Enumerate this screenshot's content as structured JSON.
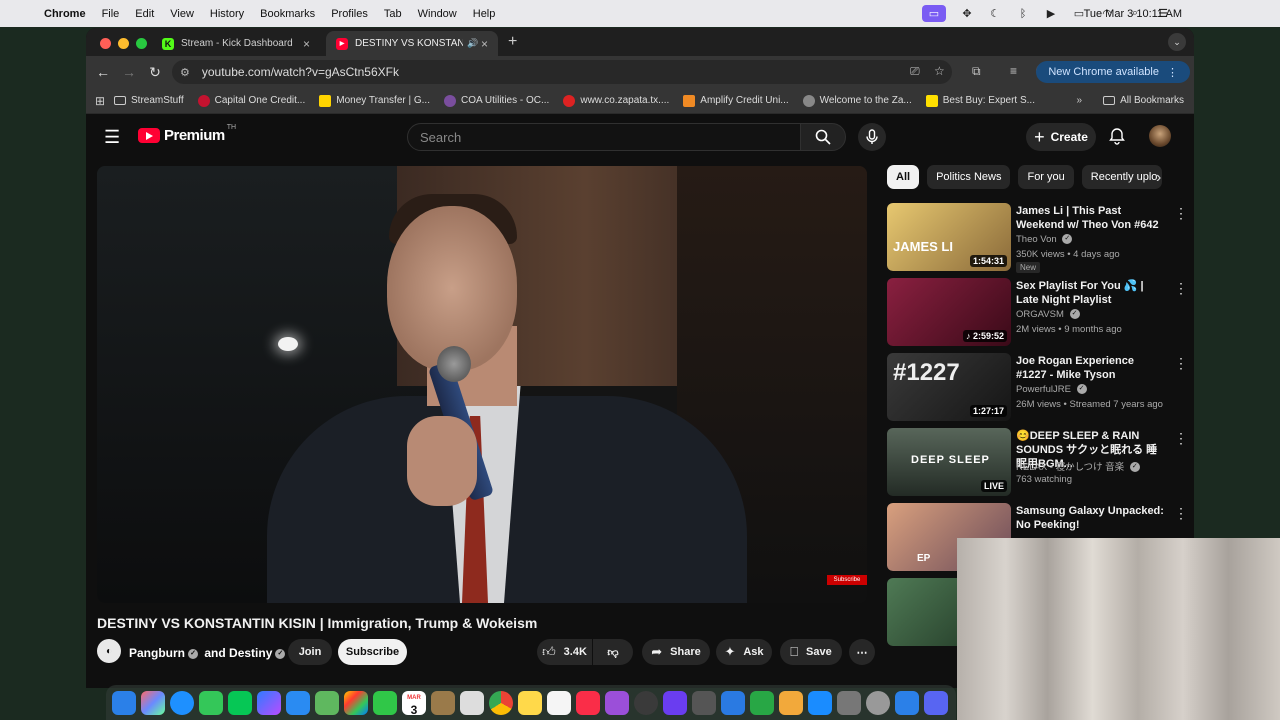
{
  "menubar": {
    "app": "Chrome",
    "items": [
      "File",
      "Edit",
      "View",
      "History",
      "Bookmarks",
      "Profiles",
      "Tab",
      "Window",
      "Help"
    ],
    "clock": "Tue Mar 3  10:11 AM"
  },
  "tabs": [
    {
      "title": "Stream - Kick Dashboard",
      "favicon": "K",
      "color": "#53fc18"
    },
    {
      "title": "DESTINY VS KONSTANTIN",
      "favicon": "▶",
      "color": "#ff0033"
    }
  ],
  "toolbar": {
    "url": "youtube.com/watch?v=gAsCtn56XFk",
    "new_chrome": "New Chrome available"
  },
  "bookmarks": {
    "items": [
      {
        "label": "StreamStuff",
        "icon": "folder-icon"
      },
      {
        "label": "Capital One Credit...",
        "color": "#c4122f"
      },
      {
        "label": "Money Transfer | G...",
        "color": "#ffd400"
      },
      {
        "label": "COA Utilities - OC...",
        "color": "#7a4e9e"
      },
      {
        "label": "www.co.zapata.tx....",
        "color": "#d22"
      },
      {
        "label": "Amplify Credit Uni...",
        "color": "#f08a24"
      },
      {
        "label": "Welcome to the Za...",
        "color": "#888"
      },
      {
        "label": "Best Buy: Expert S...",
        "color": "#ffe000"
      }
    ],
    "more": "»",
    "all": "All Bookmarks"
  },
  "youtube": {
    "logo_text": "Premium",
    "country": "TH",
    "search_placeholder": "Search",
    "create_label": "Create",
    "video": {
      "title": "DESTINY VS KONSTANTIN KISIN | Immigration, Trump & Wokeism",
      "channel_a": "Pangburn",
      "channel_joiner": "and",
      "channel_b": "Destiny",
      "join": "Join",
      "subscribe": "Subscribe",
      "likes": "3.4K",
      "share": "Share",
      "ask": "Ask",
      "save": "Save",
      "watermark": "Subscribe"
    },
    "chips": [
      "All",
      "Politics News",
      "For you",
      "Recently uplo"
    ],
    "recommendations": [
      {
        "title": "James Li | This Past Weekend w/ Theo Von #642",
        "channel": "Theo Von",
        "meta": "350K views • 4 days ago",
        "badge": "New",
        "duration": "1:54:31",
        "thumb_text": "JAMES LI",
        "thumb_bg": "#c9a44a"
      },
      {
        "title": "Sex Playlist For You 💦 | Late Night Playlist",
        "channel": "ORGAVSM",
        "meta": "2M views • 9 months ago",
        "badge": "",
        "duration": "♪ 2:59:52",
        "thumb_text": "",
        "thumb_bg": "#6a1830"
      },
      {
        "title": "Joe Rogan Experience #1227 - Mike Tyson",
        "channel": "PowerfulJRE",
        "meta": "26M views • Streamed 7 years ago",
        "badge": "",
        "duration": "1:27:17",
        "thumb_text": "#1227",
        "thumb_bg": "#2b2b2b"
      },
      {
        "title": "😊DEEP SLEEP & RAIN SOUNDS サクッと眠れる 睡眠用BGM...",
        "channel": "RELAX - 寝かしつけ 音楽",
        "meta": "763 watching",
        "badge": "",
        "duration": "LIVE",
        "thumb_text": "DEEP SLEEP",
        "thumb_bg": "#3b4a40"
      },
      {
        "title": "Samsung Galaxy Unpacked: No Peeking!",
        "channel": "",
        "meta": "",
        "badge": "",
        "duration": "",
        "thumb_text": "EP",
        "thumb_bg": "#c08a6a"
      },
      {
        "title": "",
        "channel": "",
        "meta": "",
        "badge": "",
        "duration": "",
        "thumb_text": "",
        "thumb_bg": "#2f4a35"
      }
    ]
  },
  "dock": {
    "calendar_month": "MAR",
    "calendar_day": "3"
  }
}
